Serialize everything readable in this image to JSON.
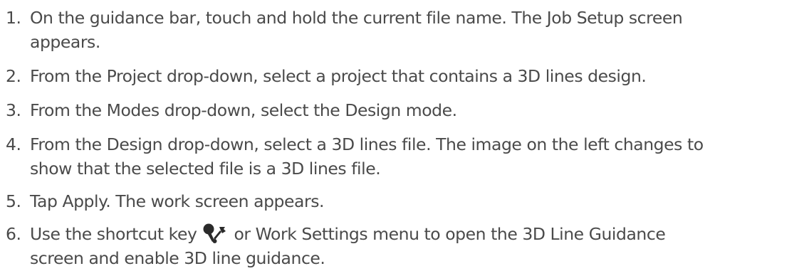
{
  "steps": [
    {
      "number": "1.",
      "lines": [
        "On the guidance bar, touch and hold the current file name. The Job Setup screen",
        "appears."
      ]
    },
    {
      "number": "2.",
      "lines": [
        "From the Project drop-down, select a project that contains a 3D lines design."
      ]
    },
    {
      "number": "3.",
      "lines": [
        "From the Modes drop-down, select the Design mode."
      ]
    },
    {
      "number": "4.",
      "lines": [
        "From the Design drop-down, select a 3D lines file. The image on the left changes to",
        "show that the selected file is a 3D lines file."
      ]
    },
    {
      "number": "5.",
      "lines": [
        "Tap Apply. The work screen appears."
      ]
    },
    {
      "number": "6.",
      "before_icon": "Use the shortcut key",
      "icon": "shortcut-key-icon",
      "after_icon": " or Work Settings menu to open the 3D Line Guidance",
      "line2": "screen and enable 3D line guidance."
    }
  ]
}
